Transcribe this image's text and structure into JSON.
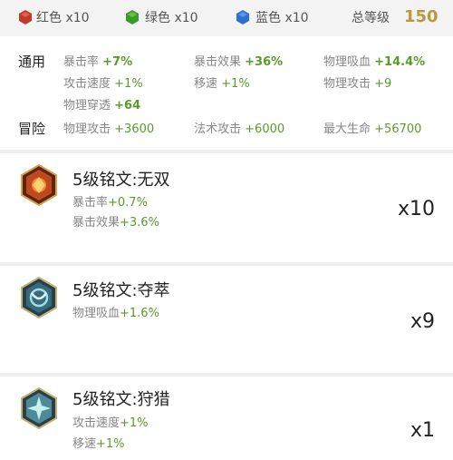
{
  "gems": [
    {
      "name": "红色",
      "label": "红色 x10",
      "icon": "red-gem-icon",
      "color": "#c0392b"
    },
    {
      "name": "绿色",
      "label": "绿色 x10",
      "icon": "green-gem-icon",
      "color": "#3a9a2a"
    },
    {
      "name": "蓝色",
      "label": "蓝色 x10",
      "icon": "blue-gem-icon",
      "color": "#2f6fd0"
    }
  ],
  "total": {
    "label": "总等级",
    "value": "150"
  },
  "categories": {
    "general": "通用",
    "adventure": "冒险"
  },
  "general_stats": [
    {
      "name": "暴击率",
      "value": "+7%"
    },
    {
      "name": "暴击效果",
      "value": "+36%"
    },
    {
      "name": "物理吸血",
      "value": "+14.4%"
    },
    {
      "name": "攻击速度",
      "value": "+1%"
    },
    {
      "name": "移速",
      "value": "+1%"
    },
    {
      "name": "物理攻击",
      "value": "+9"
    },
    {
      "name": "物理穿透",
      "value": "+64"
    }
  ],
  "adventure_stats": [
    {
      "name": "物理攻击",
      "value": "+3600"
    },
    {
      "name": "法术攻击",
      "value": "+6000"
    },
    {
      "name": "最大生命",
      "value": "+56700"
    }
  ],
  "inscriptions": [
    {
      "title": "5级铭文:无双",
      "count": "x10",
      "icon": "red-emblem-icon",
      "stats": [
        {
          "name": "暴击率",
          "value": "+0.7%"
        },
        {
          "name": "暴击效果",
          "value": "+3.6%"
        }
      ]
    },
    {
      "title": "5级铭文:夺萃",
      "count": "x9",
      "icon": "green-emblem-icon",
      "stats": [
        {
          "name": "物理吸血",
          "value": "+1.6%"
        }
      ]
    },
    {
      "title": "5级铭文:狩猎",
      "count": "x1",
      "icon": "blue-emblem-icon",
      "stats": [
        {
          "name": "攻击速度",
          "value": "+1%"
        },
        {
          "name": "移速",
          "value": "+1%"
        }
      ]
    }
  ]
}
